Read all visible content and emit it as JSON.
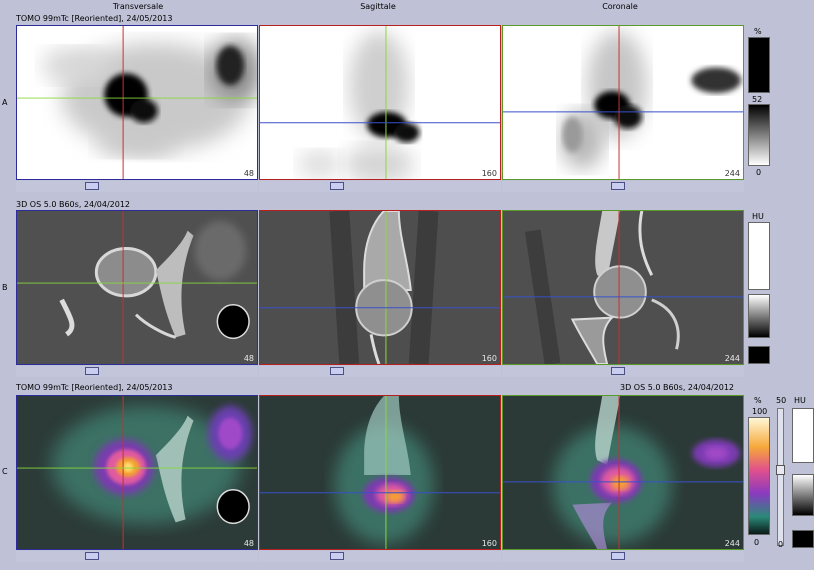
{
  "columns": [
    "Transversale",
    "Sagittale",
    "Coronale"
  ],
  "rows": [
    {
      "label": "A",
      "title": "TOMO 99mTc [Reoriented], 24/05/2013",
      "slices": [
        "48",
        "160",
        "244"
      ]
    },
    {
      "label": "B",
      "title": "3D  OS  5.0  B60s, 24/04/2012",
      "slices": [
        "48",
        "160",
        "244"
      ]
    },
    {
      "label": "C",
      "title": "TOMO 99mTc [Reoriented], 24/05/2013",
      "title_right": "3D  OS  5.0  B60s, 24/04/2012",
      "slices": [
        "48",
        "160",
        "244"
      ]
    }
  ],
  "scale_A": {
    "unit": "%",
    "mid": "52",
    "bottom": "0"
  },
  "scale_B": {
    "unit": "HU"
  },
  "scale_C": {
    "unit": "%",
    "top": "100",
    "bottom": "0",
    "fusion_top": "50",
    "fusion_bottom": "0",
    "ct_unit": "HU"
  },
  "colors": {
    "transversal_border": "#2c2c9a",
    "sagittal_border": "#b82020",
    "coronal_border": "#5a9a2a",
    "cursor_red": "#c83030",
    "cursor_green": "#88d83a",
    "cursor_blue": "#3850c8"
  },
  "icons": [
    "slice-slider-icon"
  ]
}
